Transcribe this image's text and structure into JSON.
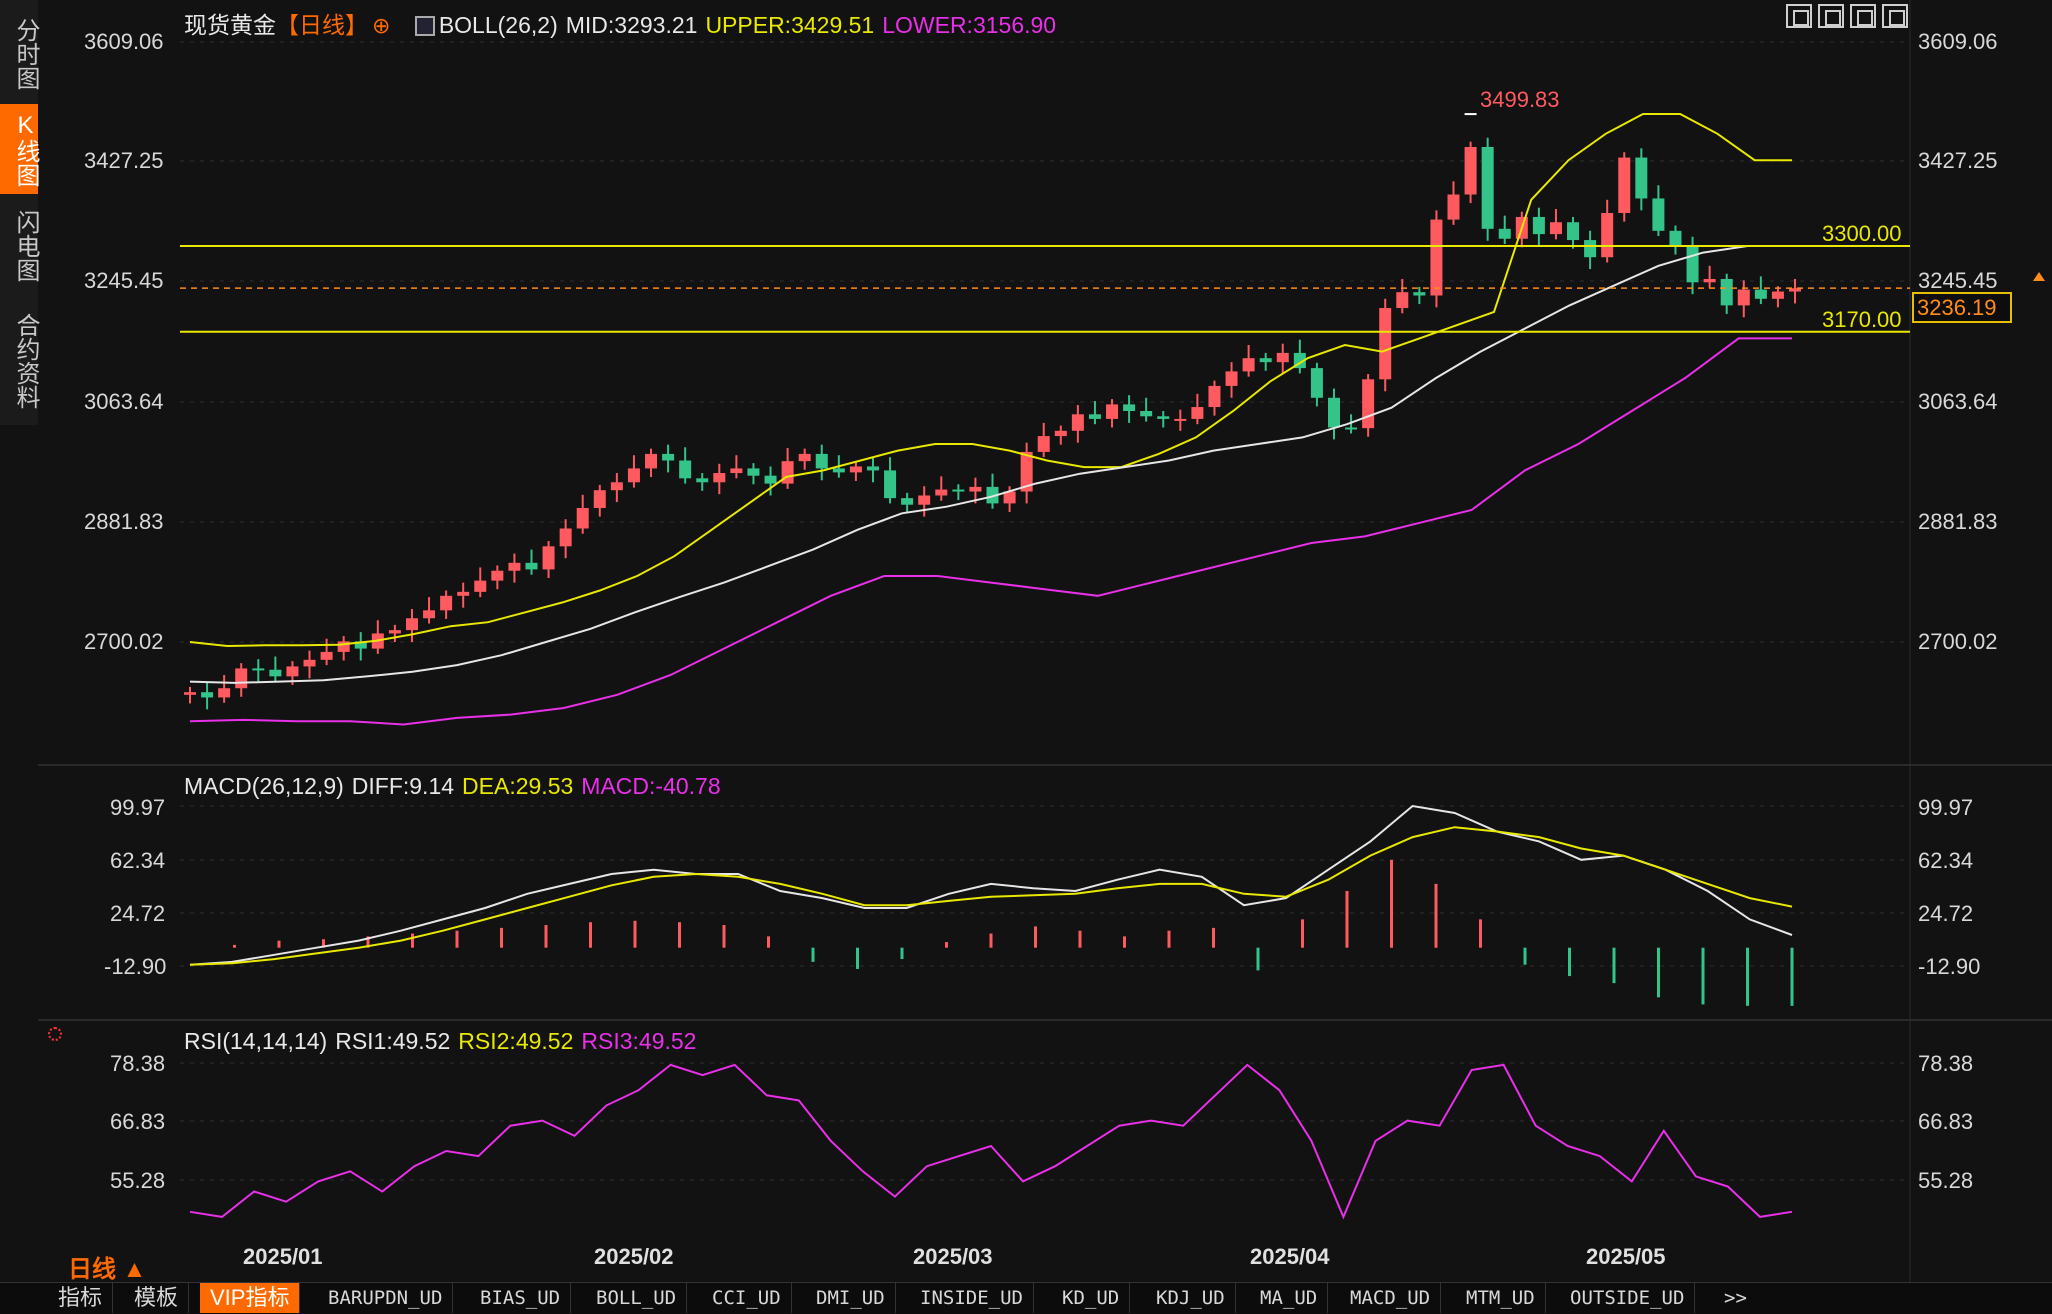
{
  "side_tabs": [
    "分时图",
    "K线图",
    "闪电图",
    "合约资料"
  ],
  "main": {
    "symbol": "现货黄金",
    "period_tag": "【日线】",
    "boll_label": "BOLL(26,2)",
    "mid": "MID:3293.21",
    "upper": "UPPER:3429.51",
    "lower": "LOWER:3156.90",
    "y_ticks": [
      "3609.06",
      "3427.25",
      "3245.45",
      "3063.64",
      "2881.83",
      "2700.02"
    ],
    "high_label": "3499.83",
    "level_high": "3300.00",
    "level_low": "3170.00",
    "last_price": "3236.19"
  },
  "macd": {
    "label": "MACD(26,12,9)",
    "diff": "DIFF:9.14",
    "dea": "DEA:29.53",
    "macd": "MACD:-40.78",
    "y_ticks": [
      "99.97",
      "62.34",
      "24.72",
      "-12.90"
    ]
  },
  "rsi": {
    "label": "RSI(14,14,14)",
    "rsi1": "RSI1:49.52",
    "rsi2": "RSI2:49.52",
    "rsi3": "RSI3:49.52",
    "y_ticks": [
      "78.38",
      "66.83",
      "55.28"
    ]
  },
  "x_dates": [
    "2025/01",
    "2025/02",
    "2025/03",
    "2025/04",
    "2025/05"
  ],
  "period_button": "日线",
  "bottom_tabs": [
    "指标",
    "模板",
    "VIP指标",
    "BARUPDN_UD",
    "BIAS_UD",
    "BOLL_UD",
    "CCI_UD",
    "DMI_UD",
    "INSIDE_UD",
    "KD_UD",
    "KDJ_UD",
    "MA_UD",
    "MACD_UD",
    "MTM_UD",
    "OUTSIDE_UD",
    ">>"
  ],
  "colors": {
    "up": "#ff5a5f",
    "down": "#34c48a",
    "boll_upper": "#e8e800",
    "boll_mid": "#e6e6e6",
    "boll_lower": "#e830e8",
    "level": "#e8e800",
    "high_label": "#ff5a5f",
    "accent": "#ff6a00"
  },
  "chart_data": [
    {
      "type": "candlestick",
      "title": "现货黄金【日线】 BOLL(26,2)",
      "x_ticks": [
        "2025/01",
        "2025/02",
        "2025/03",
        "2025/04",
        "2025/05"
      ],
      "ylim": [
        2600,
        3640
      ],
      "y_ticks": [
        2700.02,
        2881.83,
        3063.64,
        3245.45,
        3427.25,
        3609.06
      ],
      "annotations": [
        {
          "label": "3499.83",
          "value": 3499.83
        }
      ],
      "hlines": [
        3300.0,
        3170.0
      ],
      "last_price": 3236.19,
      "ohlc_start_close": 2620,
      "closes": [
        2624,
        2616,
        2630,
        2660,
        2658,
        2648,
        2663,
        2673,
        2685,
        2701,
        2690,
        2713,
        2718,
        2736,
        2748,
        2770,
        2776,
        2793,
        2808,
        2820,
        2810,
        2845,
        2872,
        2903,
        2930,
        2942,
        2963,
        2985,
        2975,
        2948,
        2942,
        2956,
        2963,
        2952,
        2940,
        2974,
        2985,
        2963,
        2957,
        2966,
        2960,
        2918,
        2908,
        2922,
        2931,
        2928,
        2935,
        2910,
        2928,
        2988,
        3012,
        3020,
        3045,
        3038,
        3060,
        3050,
        3042,
        3038,
        3038,
        3056,
        3088,
        3110,
        3130,
        3124,
        3138,
        3115,
        3070,
        3025,
        3024,
        3098,
        3206,
        3230,
        3225,
        3340,
        3378,
        3450,
        3326,
        3311,
        3344,
        3318,
        3336,
        3309,
        3283,
        3350,
        3434,
        3372,
        3323,
        3300,
        3245,
        3250,
        3210,
        3234,
        3220,
        3231,
        3236
      ],
      "boll_upper": [
        2700,
        2694,
        2695,
        2695,
        2696,
        2702,
        2712,
        2724,
        2730,
        2745,
        2760,
        2778,
        2800,
        2830,
        2870,
        2910,
        2950,
        2960,
        2975,
        2990,
        3000,
        3000,
        2990,
        2975,
        2965,
        2965,
        2985,
        3010,
        3050,
        3095,
        3130,
        3150,
        3140,
        3160,
        3180,
        3200,
        3370,
        3430,
        3470,
        3500,
        3500,
        3470,
        3430,
        3430
      ],
      "boll_mid": [
        2640,
        2638,
        2640,
        2642,
        2648,
        2655,
        2665,
        2680,
        2700,
        2720,
        2745,
        2768,
        2790,
        2815,
        2840,
        2870,
        2895,
        2905,
        2920,
        2940,
        2955,
        2965,
        2975,
        2990,
        3000,
        3010,
        3030,
        3055,
        3100,
        3140,
        3175,
        3210,
        3240,
        3270,
        3290,
        3300,
        3300
      ],
      "boll_lower": [
        2580,
        2582,
        2580,
        2580,
        2575,
        2585,
        2590,
        2600,
        2620,
        2650,
        2690,
        2730,
        2770,
        2800,
        2800,
        2790,
        2780,
        2770,
        2790,
        2810,
        2830,
        2850,
        2860,
        2880,
        2900,
        2960,
        3000,
        3050,
        3100,
        3160,
        3160
      ]
    },
    {
      "type": "line",
      "title": "MACD(26,12,9)",
      "ylim": [
        -30,
        110
      ],
      "y_ticks": [
        -12.9,
        24.72,
        62.34,
        99.97
      ],
      "series": [
        {
          "name": "DIFF",
          "values": [
            -12,
            -10,
            -5,
            0,
            5,
            12,
            20,
            28,
            38,
            45,
            52,
            55,
            52,
            52,
            40,
            35,
            28,
            28,
            38,
            45,
            42,
            40,
            48,
            55,
            50,
            30,
            35,
            55,
            75,
            100,
            95,
            82,
            75,
            62,
            65,
            55,
            40,
            20,
            9
          ]
        },
        {
          "name": "DEA",
          "values": [
            -12,
            -11,
            -8,
            -4,
            0,
            5,
            12,
            20,
            28,
            36,
            44,
            50,
            52,
            50,
            45,
            38,
            30,
            30,
            33,
            36,
            37,
            38,
            42,
            45,
            45,
            38,
            36,
            48,
            65,
            78,
            85,
            82,
            78,
            70,
            65,
            55,
            45,
            35,
            29
          ]
        },
        {
          "name": "MACD",
          "values": [
            0,
            2,
            5,
            6,
            8,
            10,
            12,
            14,
            16,
            18,
            19,
            18,
            16,
            8,
            -10,
            -15,
            -8,
            4,
            10,
            15,
            12,
            8,
            12,
            14,
            -16,
            20,
            40,
            62,
            45,
            20,
            -12,
            -20,
            -25,
            -35,
            -40,
            -41,
            -41
          ]
        }
      ]
    },
    {
      "type": "line",
      "title": "RSI(14,14,14)",
      "ylim": [
        46,
        82
      ],
      "y_ticks": [
        55.28,
        66.83,
        78.38
      ],
      "series": [
        {
          "name": "RSI1",
          "values": [
            49,
            48,
            53,
            51,
            55,
            57,
            53,
            58,
            61,
            60,
            66,
            67,
            64,
            70,
            73,
            78,
            76,
            78,
            72,
            71,
            63,
            57,
            52,
            58,
            60,
            62,
            55,
            58,
            62,
            66,
            67,
            66,
            72,
            78,
            73,
            63,
            48,
            63,
            67,
            66,
            77,
            78,
            66,
            62,
            60,
            55,
            65,
            56,
            54,
            48,
            49
          ]
        },
        {
          "name": "RSI2",
          "values": [
            49,
            48,
            53,
            51,
            55,
            57,
            53,
            58,
            61,
            60,
            66,
            67,
            64,
            70,
            73,
            78,
            76,
            78,
            72,
            71,
            63,
            57,
            52,
            58,
            60,
            62,
            55,
            58,
            62,
            66,
            67,
            66,
            72,
            78,
            73,
            63,
            48,
            63,
            67,
            66,
            77,
            78,
            66,
            62,
            60,
            55,
            65,
            56,
            54,
            48,
            49
          ]
        },
        {
          "name": "RSI3",
          "values": [
            49,
            48,
            53,
            51,
            55,
            57,
            53,
            58,
            61,
            60,
            66,
            67,
            64,
            70,
            73,
            78,
            76,
            78,
            72,
            71,
            63,
            57,
            52,
            58,
            60,
            62,
            55,
            58,
            62,
            66,
            67,
            66,
            72,
            78,
            73,
            63,
            48,
            63,
            67,
            66,
            77,
            78,
            66,
            62,
            60,
            55,
            65,
            56,
            54,
            48,
            49
          ]
        }
      ]
    }
  ]
}
